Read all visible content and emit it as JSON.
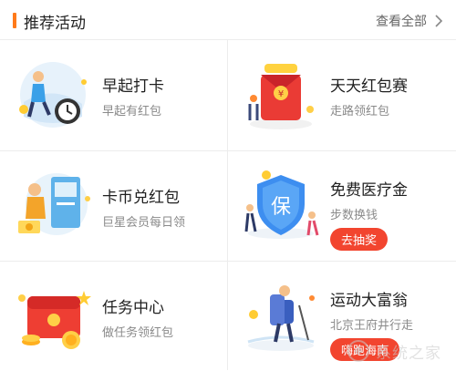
{
  "header": {
    "title": "推荐活动",
    "more_label": "查看全部",
    "accent": "#ff7a1a"
  },
  "cards": [
    {
      "name": "早起打卡",
      "sub": "早起有红包"
    },
    {
      "name": "天天红包赛",
      "sub": "走路领红包"
    },
    {
      "name": "卡币兑红包",
      "sub": "巨星会员每日领"
    },
    {
      "name": "免费医疗金",
      "sub": "步数换钱",
      "button": "去抽奖"
    },
    {
      "name": "任务中心",
      "sub": "做任务领红包"
    },
    {
      "name": "运动大富翁",
      "sub": "北京王府井行走",
      "button": "嗨跑海南"
    }
  ],
  "watermark": "系统之家",
  "icons": [
    "chevron-right-icon",
    "alarm-clock-icon",
    "red-envelope-icon",
    "atm-icon",
    "shield-icon",
    "gift-envelope-icon",
    "hiker-icon",
    "watermark-logo"
  ],
  "colors": {
    "button": "#f2452f",
    "subtext": "#8a8a8a",
    "divider": "#ececec"
  }
}
